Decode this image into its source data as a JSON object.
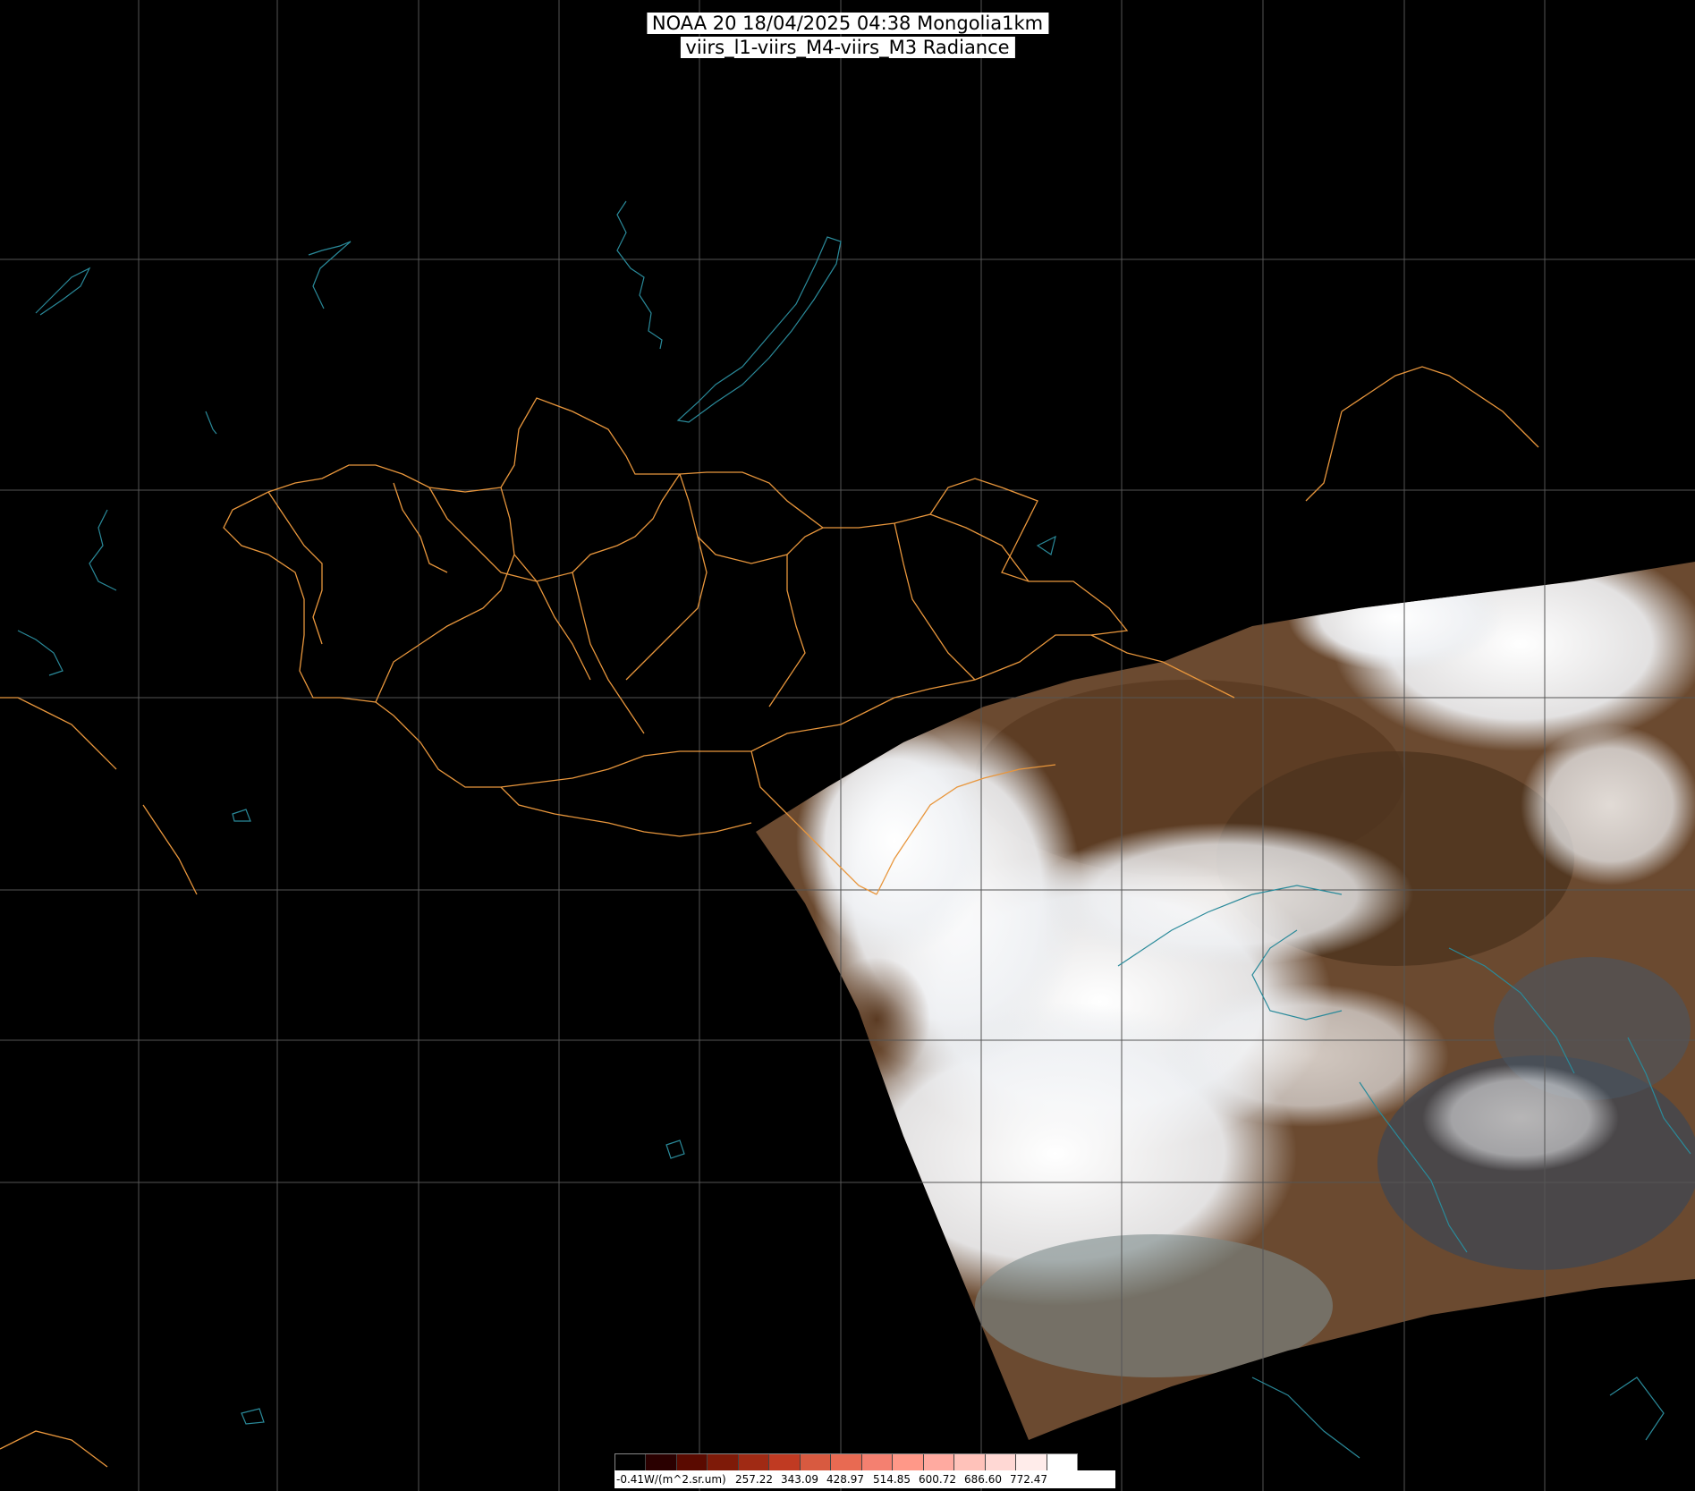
{
  "title": {
    "line1": "NOAA 20 18/04/2025 04:38 Mongolia1km",
    "line2": "viirs_l1-viirs_M4-viirs_M3 Radiance"
  },
  "colorbar": {
    "unit_label": "-0.41W/(m^2.sr.um)",
    "tick_labels": [
      "257.22",
      "343.09",
      "428.97",
      "514.85",
      "600.72",
      "686.60",
      "772.47"
    ],
    "colors": [
      "#000000",
      "#2a0000",
      "#5a0a00",
      "#7e1a08",
      "#a02a14",
      "#c03a22",
      "#d85a40",
      "#e86a52",
      "#f48070",
      "#ff9888",
      "#ffaaa0",
      "#ffc2ba",
      "#ffd8d4",
      "#ffecea",
      "#ffffff"
    ]
  },
  "colors": {
    "border_color": "#e8963c",
    "coast_color": "#2a8a9a",
    "grid_color": "#555555",
    "cloud_color": "#f4f6f8",
    "land_color": "#6b4a30"
  }
}
